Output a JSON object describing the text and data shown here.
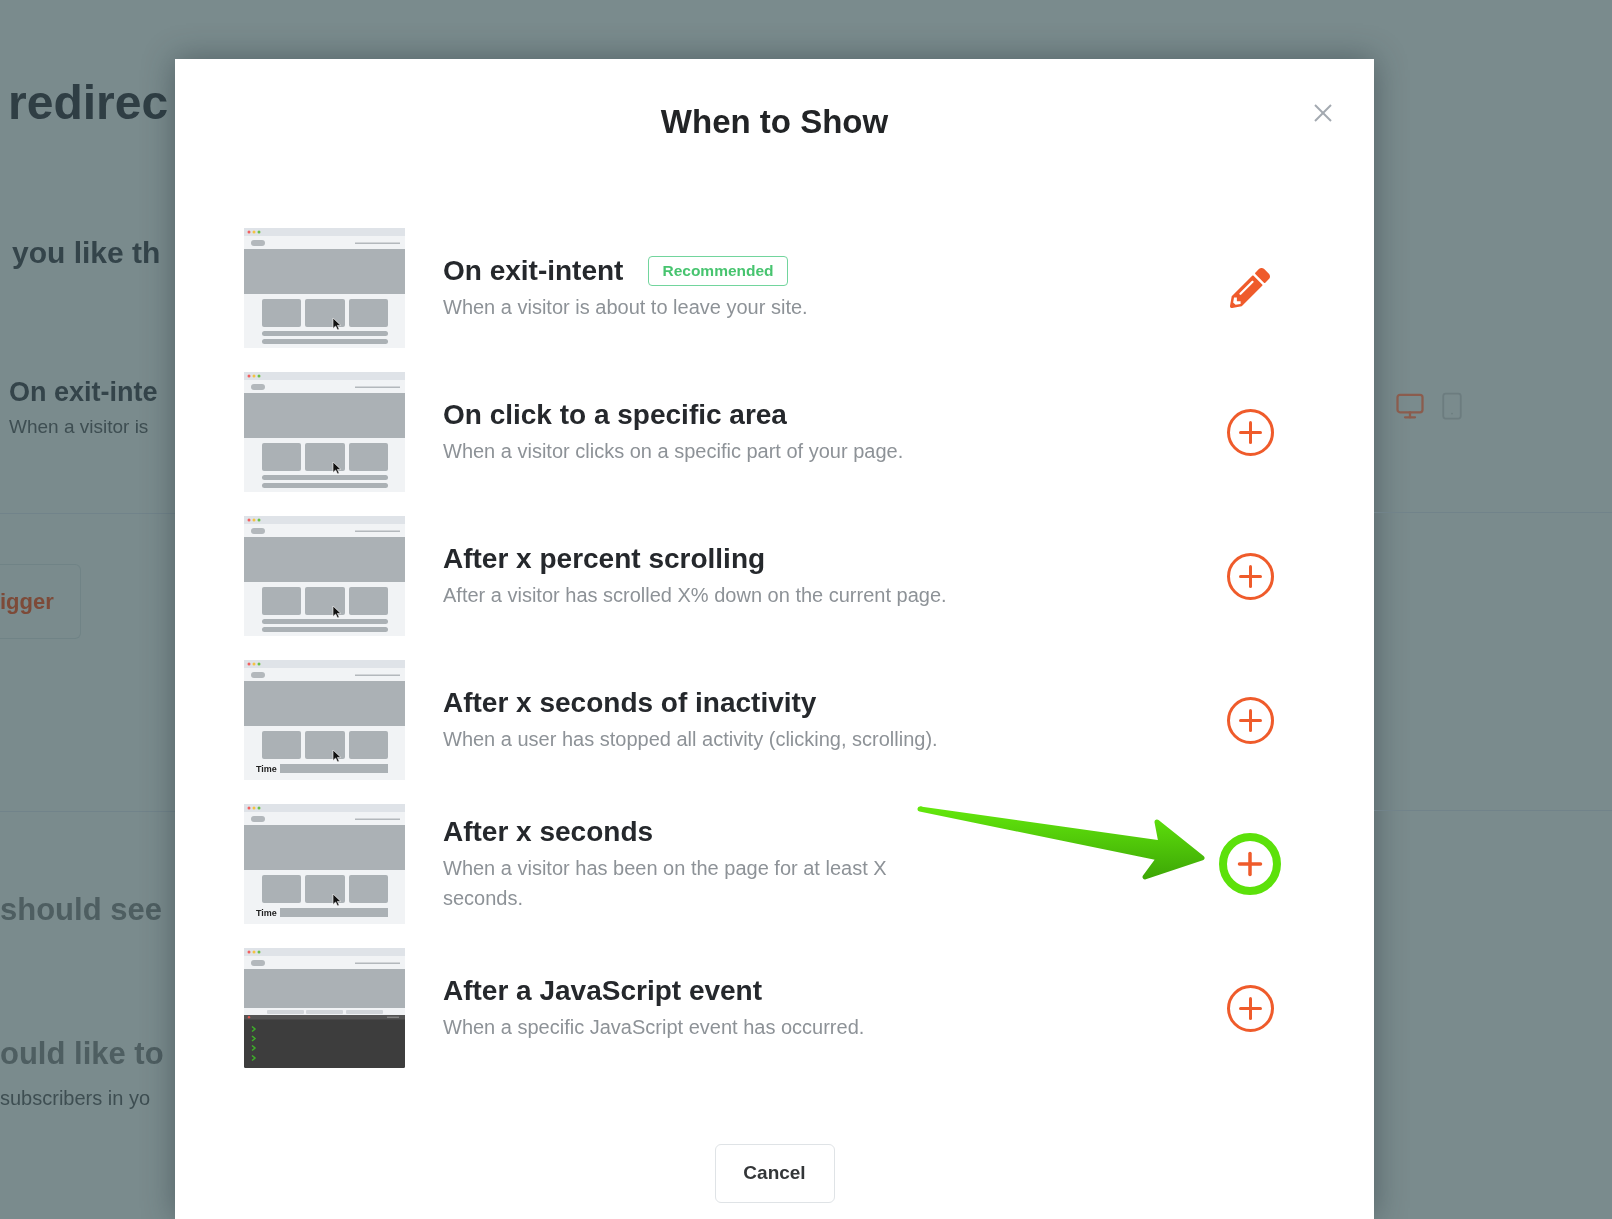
{
  "background": {
    "heading": "redirec",
    "question": "you like th",
    "trigger": {
      "title": "On exit-inte",
      "description": "When a visitor is"
    },
    "button": "igger",
    "section_1": {
      "title": "should see"
    },
    "section_2": {
      "title": "ould like to",
      "description": "subscribers in yo"
    },
    "devices": [
      {
        "kind": "desktop",
        "selected": true
      },
      {
        "kind": "mobile",
        "selected": false
      }
    ]
  },
  "dialog": {
    "title": "When to Show",
    "options": [
      {
        "title": "On exit-intent",
        "badge": "Recommended",
        "description": "When a visitor is about to leave your site.",
        "thumbnail": {
          "kind": "cards"
        },
        "action": {
          "kind": "edit"
        },
        "highlighted": false
      },
      {
        "title": "On click to a specific area",
        "description": "When a visitor clicks on a specific part of your page.",
        "thumbnail": {
          "kind": "cards"
        },
        "action": {
          "kind": "add"
        },
        "highlighted": false
      },
      {
        "title": "After x percent scrolling",
        "description": "After a visitor has scrolled X% down on the current page.",
        "thumbnail": {
          "kind": "cards"
        },
        "action": {
          "kind": "add"
        },
        "highlighted": false
      },
      {
        "title": "After x seconds of inactivity",
        "description": "When a user has stopped all activity (clicking, scrolling).",
        "thumbnail": {
          "kind": "timer",
          "label": "Time"
        },
        "action": {
          "kind": "add"
        },
        "highlighted": false
      },
      {
        "title": "After x seconds",
        "description": "When a visitor has been on the page for at least X seconds.",
        "thumbnail": {
          "kind": "timer",
          "label": "Time"
        },
        "action": {
          "kind": "add"
        },
        "highlighted": true
      },
      {
        "title": "After a JavaScript event",
        "description": "When a specific JavaScript event has occurred.",
        "thumbnail": {
          "kind": "console"
        },
        "action": {
          "kind": "add"
        },
        "highlighted": false
      }
    ],
    "cancel": "Cancel"
  }
}
